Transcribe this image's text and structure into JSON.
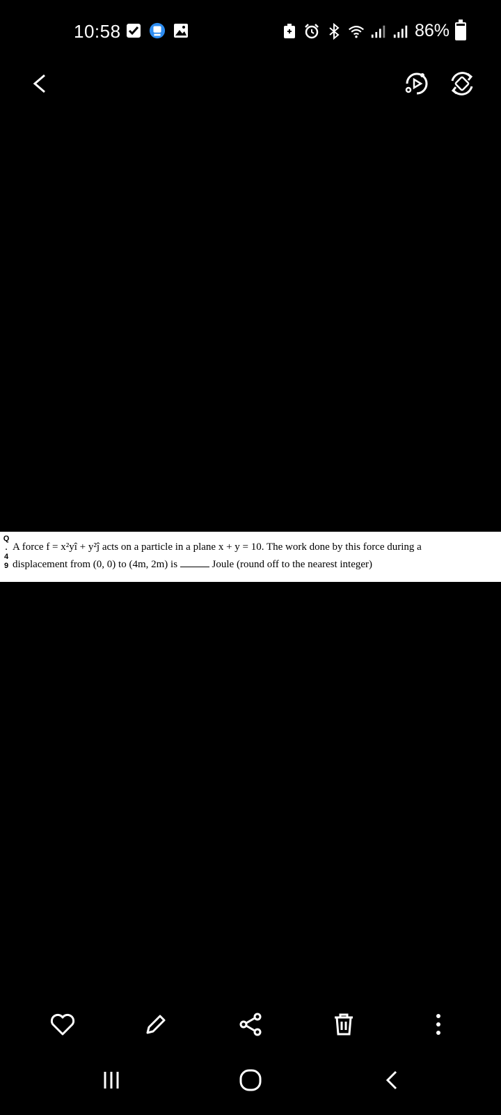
{
  "status_bar": {
    "time": "10:58",
    "battery_text": "86%",
    "battery_level": 0.86,
    "left_icons": [
      "checkbox-notification-icon",
      "app-notification-icon",
      "gallery-notification-icon"
    ],
    "right_icons": [
      "battery-saver-icon",
      "alarm-icon",
      "bluetooth-icon",
      "wifi-icon",
      "signal-1-icon",
      "signal-2-icon"
    ]
  },
  "top_bar": {
    "actions": [
      "back-icon",
      "remaster-icon",
      "rotate-icon"
    ]
  },
  "question": {
    "number_chars": [
      "Q",
      ".",
      "4",
      "9"
    ],
    "line1_prefix": "A force ",
    "force_expr": "f = x²yî + y²ĵ",
    "line1_suffix": " acts on a particle in a plane x + y = 10. The work done by this force during a",
    "line2_prefix": "displacement from (0, 0) to (4m, 2m) is ",
    "line2_suffix": " Joule (round off to the nearest integer)"
  },
  "bottom_actions": [
    "favorite-icon",
    "edit-icon",
    "share-icon",
    "delete-icon",
    "more-icon"
  ],
  "nav": [
    "recents-icon",
    "home-icon",
    "back-nav-icon"
  ]
}
